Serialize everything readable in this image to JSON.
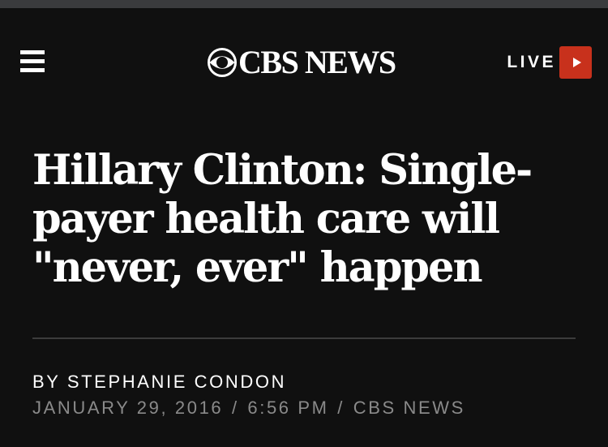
{
  "header": {
    "logo_text": "CBS NEWS",
    "live_label": "LIVE"
  },
  "article": {
    "headline": "Hillary Clinton: Single-payer health care will \"never, ever\" happen",
    "byline_prefix": "BY",
    "author": "STEPHANIE CONDON",
    "date": "JANUARY 29, 2016",
    "separator": "/",
    "time": "6:56 PM",
    "source": "CBS NEWS"
  },
  "colors": {
    "background": "#101010",
    "top_strip": "#3a3b3d",
    "live_button": "#c8311c",
    "meta_text": "#8a8a8a",
    "divider": "#3c3c3c"
  },
  "icons": {
    "menu": "hamburger-menu-icon",
    "logo": "cbs-eye-icon",
    "live": "play-icon"
  }
}
